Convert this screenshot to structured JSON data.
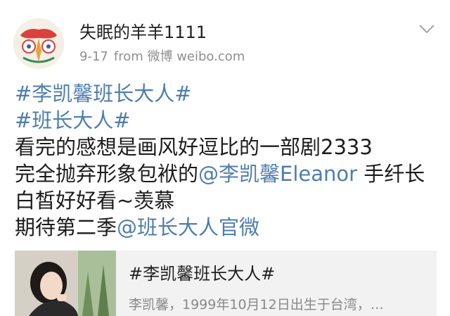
{
  "post": {
    "username": "失眠的羊羊1111",
    "date": "9-17",
    "source": "from 微博 weibo.com",
    "avatar": "user-avatar",
    "menu_icon": "chevron-down-icon",
    "lines": [
      [
        {
          "text": "#李凯馨班长大人#",
          "link": true
        }
      ],
      [
        {
          "text": "#班长大人#",
          "link": true
        }
      ],
      [
        {
          "text": "看完的感想是画风好逗比的一部剧2333",
          "link": false
        }
      ],
      [
        {
          "text": "完全抛弃形象包袱的",
          "link": false
        },
        {
          "text": "@李凯馨Eleanor",
          "link": true
        },
        {
          "text": " 手纤长",
          "link": false
        }
      ],
      [
        {
          "text": "白皙好好看~羡慕",
          "link": false
        }
      ],
      [
        {
          "text": "期待第二季",
          "link": false
        },
        {
          "text": "@班长大人官微",
          "link": true
        }
      ]
    ],
    "card": {
      "title": "#李凯馨班长大人#",
      "description": "李凯馨，1999年10月12日出生于台湾，…"
    }
  },
  "colors": {
    "link": "#4f7db0",
    "meta_text": "#8f8f8f",
    "card_bg": "#f2f2f2"
  }
}
